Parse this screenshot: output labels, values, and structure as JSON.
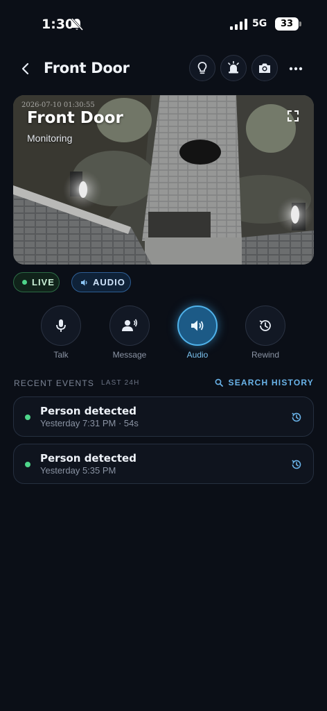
{
  "status_bar": {
    "time": "1:30",
    "network": "5G",
    "battery": "33"
  },
  "header": {
    "title": "Front Door"
  },
  "feed": {
    "timestamp": "2026-07-10 01:30:55",
    "title": "Front Door",
    "subtitle": "Monitoring"
  },
  "badges": {
    "live": "LIVE",
    "audio": "AUDIO"
  },
  "controls": [
    {
      "label": "Talk",
      "icon": "microphone-icon"
    },
    {
      "label": "Message",
      "icon": "message-speaker-icon"
    },
    {
      "label": "Audio",
      "icon": "speaker-icon",
      "active": true
    },
    {
      "label": "Rewind",
      "icon": "history-icon"
    }
  ],
  "events": {
    "title": "RECENT EVENTS",
    "range": "LAST 24H",
    "search_label": "SEARCH HISTORY",
    "items": [
      {
        "title": "Person detected",
        "meta": "Yesterday 7:31 PM · 54s"
      },
      {
        "title": "Person detected",
        "meta": "Yesterday 5:35 PM"
      }
    ]
  },
  "colors": {
    "background": "#0b0f17",
    "accent": "#4fb2ea",
    "live_green": "#4ed58a"
  }
}
